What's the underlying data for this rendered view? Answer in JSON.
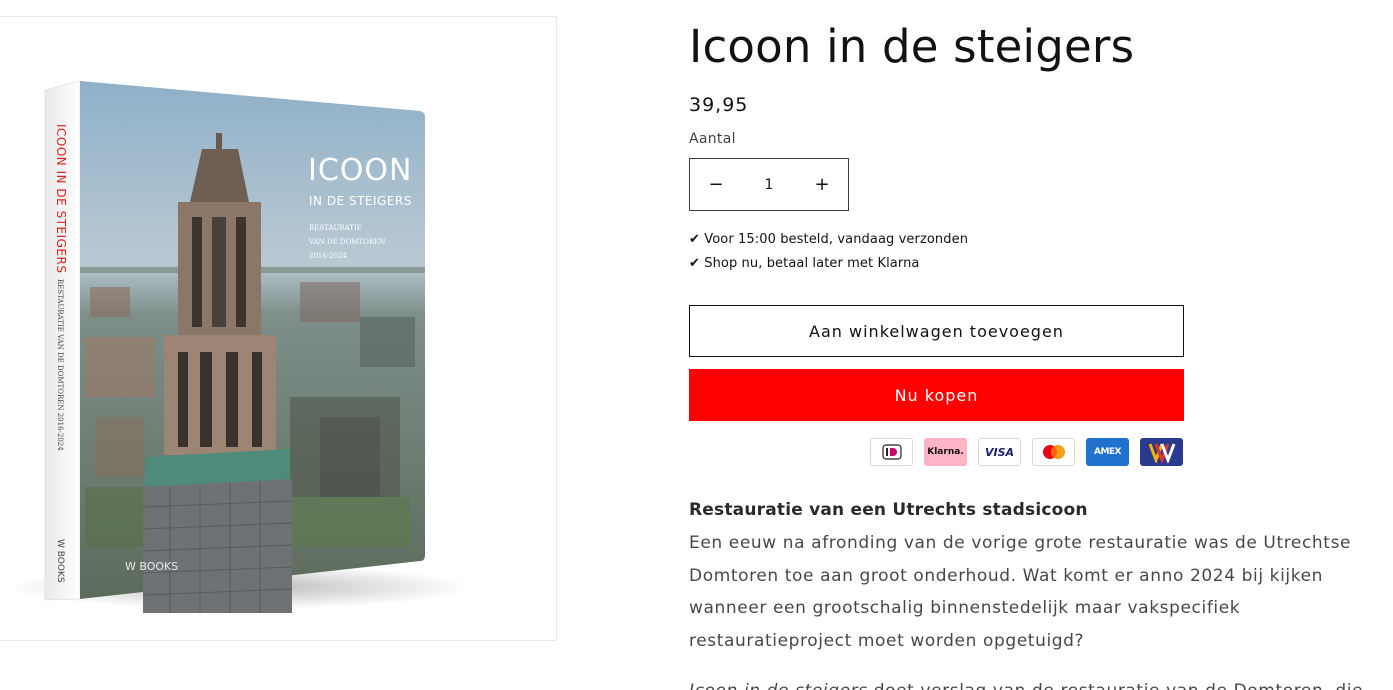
{
  "product": {
    "title": "Icoon in de steigers",
    "price": "39,95",
    "quantity_label": "Aantal",
    "quantity_value": "1",
    "decrease_symbol": "−",
    "increase_symbol": "+",
    "usps": [
      "✔ Voor 15:00 besteld, vandaag verzonden",
      "✔ Shop nu, betaal later met Klarna"
    ],
    "add_to_cart_label": "Aan winkelwagen toevoegen",
    "buy_now_label": "Nu kopen",
    "buy_now_color": "#ff0000"
  },
  "payment_methods": [
    {
      "name": "iDEAL",
      "icon": "ideal-icon"
    },
    {
      "name": "Klarna.",
      "icon": "klarna-icon"
    },
    {
      "name": "VISA",
      "icon": "visa-icon"
    },
    {
      "name": "Mastercard",
      "icon": "mastercard-icon"
    },
    {
      "name": "AMEX",
      "icon": "amex-icon"
    },
    {
      "name": "VVV",
      "icon": "vvv-icon"
    }
  ],
  "book_cover": {
    "spine_title": "ICOON IN DE STEIGERS",
    "spine_subtitle": "RESTAURATIE VAN DE DOMTOREN 2016-2024",
    "spine_publisher": "W BOOKS",
    "cover_title": "ICOON",
    "cover_subtitle": "IN DE STEIGERS",
    "cover_line1": "RESTAURATIE",
    "cover_line2": "VAN DE DOMTOREN",
    "cover_line3": "2016-2024",
    "cover_publisher": "W BOOKS"
  },
  "description": {
    "heading": "Restauratie van een Utrechts stadsicoon",
    "paragraph": "Een eeuw na afronding van de vorige grote restauratie was de Utrechtse Domtoren toe aan groot onderhoud. Wat komt er anno 2024 bij kijken wanneer een grootschalig binnenstedelijk maar vakspecifiek restauratieproject moet worden opgetuigd?",
    "paragraph2_em": "Icoon in de steigers",
    "paragraph2_rest": " doet verslag van de restauratie van de Domtoren, die"
  }
}
